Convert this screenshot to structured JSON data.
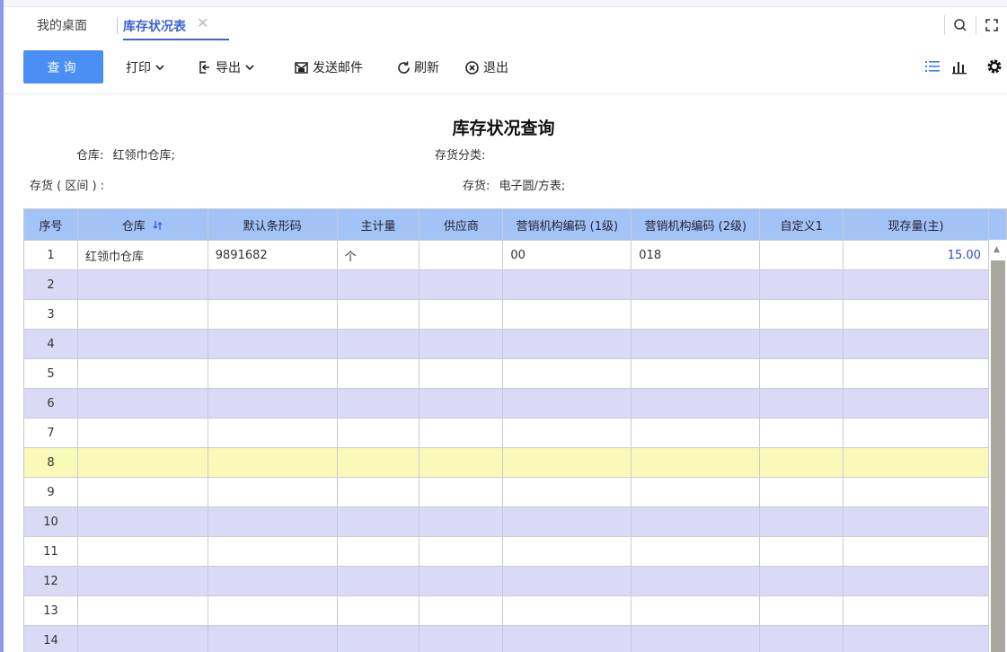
{
  "tabs": {
    "desktop": "我的桌面",
    "active": "库存状况表",
    "close_glyph": "✕"
  },
  "toolbar": {
    "query": "查询",
    "print": "打印",
    "export": "导出",
    "send_mail": "发送邮件",
    "refresh": "刷新",
    "exit": "退出"
  },
  "report": {
    "title": "库存状况查询",
    "warehouse_label": "仓库:",
    "warehouse_value": "红领巾仓库;",
    "category_label": "存货分类:",
    "category_value": "",
    "range_label": "存货 ( 区间 ) :",
    "range_value": "",
    "item_label": "存货:",
    "item_value": "电子圆/方表;"
  },
  "table": {
    "columns": [
      "序号",
      "仓库",
      "默认条形码",
      "主计量",
      "供应商",
      "营销机构编码 (1级)",
      "营销机构编码 (2级)",
      "自定义1",
      "现存量(主)"
    ],
    "rows": [
      [
        "1",
        "红领巾仓库",
        "9891682",
        "个",
        "",
        "00",
        "018",
        "",
        "15.00"
      ],
      [
        "2",
        "",
        "",
        "",
        "",
        "",
        "",
        "",
        ""
      ],
      [
        "3",
        "",
        "",
        "",
        "",
        "",
        "",
        "",
        ""
      ],
      [
        "4",
        "",
        "",
        "",
        "",
        "",
        "",
        "",
        ""
      ],
      [
        "5",
        "",
        "",
        "",
        "",
        "",
        "",
        "",
        ""
      ],
      [
        "6",
        "",
        "",
        "",
        "",
        "",
        "",
        "",
        ""
      ],
      [
        "7",
        "",
        "",
        "",
        "",
        "",
        "",
        "",
        ""
      ],
      [
        "8",
        "",
        "",
        "",
        "",
        "",
        "",
        "",
        ""
      ],
      [
        "9",
        "",
        "",
        "",
        "",
        "",
        "",
        "",
        ""
      ],
      [
        "10",
        "",
        "",
        "",
        "",
        "",
        "",
        "",
        ""
      ],
      [
        "11",
        "",
        "",
        "",
        "",
        "",
        "",
        "",
        ""
      ],
      [
        "12",
        "",
        "",
        "",
        "",
        "",
        "",
        "",
        ""
      ],
      [
        "13",
        "",
        "",
        "",
        "",
        "",
        "",
        "",
        ""
      ],
      [
        "14",
        "",
        "",
        "",
        "",
        "",
        "",
        "",
        ""
      ]
    ],
    "selected_row": "8"
  },
  "icons": {
    "search": "search-icon",
    "fullscreen": "fullscreen-icon",
    "list": "list-view-icon",
    "chart": "chart-view-icon",
    "settings": "gear-icon",
    "sort": "sort-icon"
  },
  "colors": {
    "accent": "#4b8ff5",
    "header_bg": "#a3c3f7",
    "row_alt": "#dadaf7",
    "row_selected": "#fafab8",
    "tab_active": "#3c64d8"
  }
}
